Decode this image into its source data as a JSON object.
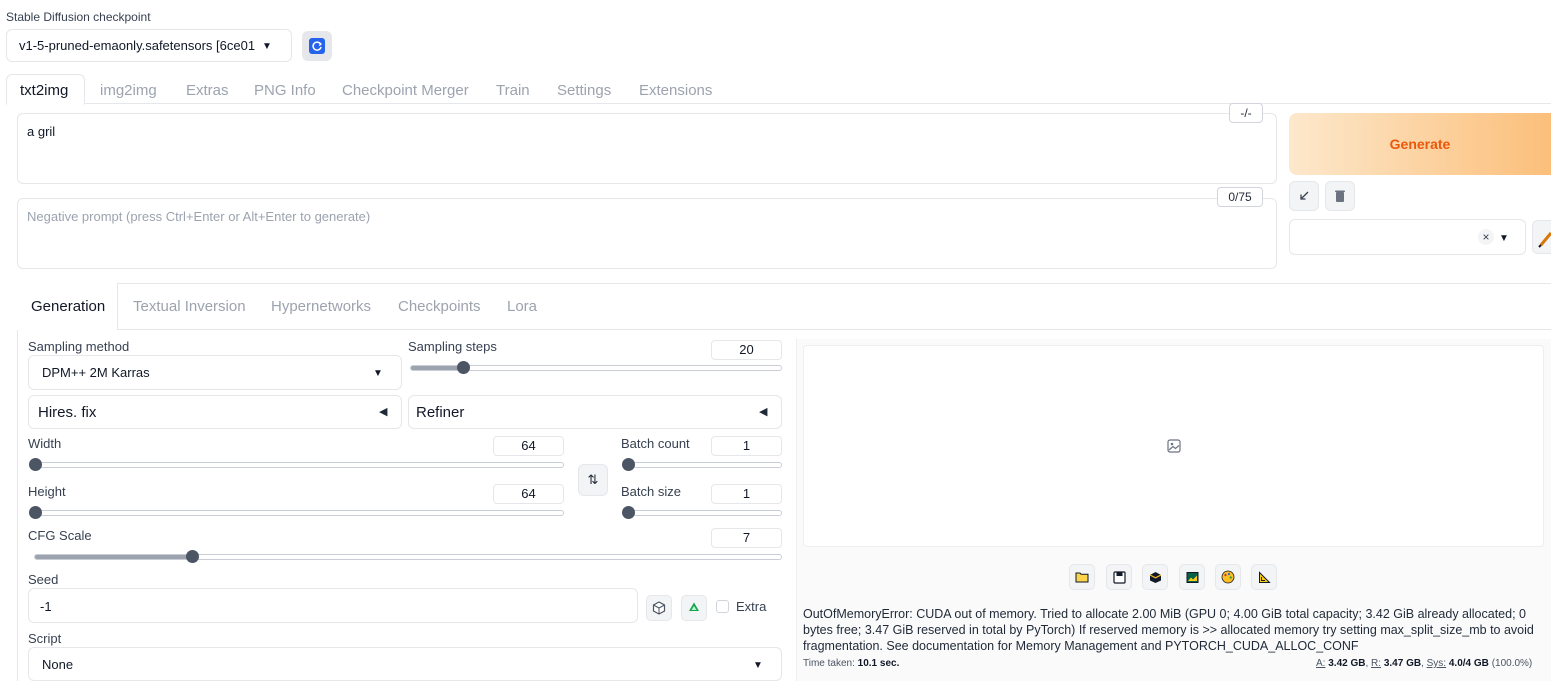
{
  "checkpoint": {
    "label": "Stable Diffusion checkpoint",
    "value": "v1-5-pruned-emaonly.safetensors [6ce01"
  },
  "main_tabs": [
    "txt2img",
    "img2img",
    "Extras",
    "PNG Info",
    "Checkpoint Merger",
    "Train",
    "Settings",
    "Extensions"
  ],
  "prompt": {
    "value": "a gril",
    "token_counter": "-/-"
  },
  "negative_prompt": {
    "placeholder": "Negative prompt (press Ctrl+Enter or Alt+Enter to generate)",
    "token_counter": "0/75"
  },
  "generate_label": "Generate",
  "styles": {
    "clear_symbol": "×"
  },
  "sub_tabs": [
    "Generation",
    "Textual Inversion",
    "Hypernetworks",
    "Checkpoints",
    "Lora"
  ],
  "sampling_method": {
    "label": "Sampling method",
    "value": "DPM++ 2M Karras"
  },
  "sampling_steps": {
    "label": "Sampling steps",
    "value": "20",
    "fraction": 0.14
  },
  "hires_fix": {
    "label": "Hires. fix"
  },
  "refiner": {
    "label": "Refiner"
  },
  "width": {
    "label": "Width",
    "value": "64",
    "fraction": 0.0
  },
  "height": {
    "label": "Height",
    "value": "64",
    "fraction": 0.0
  },
  "batch_count": {
    "label": "Batch count",
    "value": "1",
    "fraction": 0.0
  },
  "batch_size": {
    "label": "Batch size",
    "value": "1",
    "fraction": 0.0
  },
  "cfg_scale": {
    "label": "CFG Scale",
    "value": "7",
    "fraction": 0.21
  },
  "seed": {
    "label": "Seed",
    "value": "-1",
    "extra_label": "Extra"
  },
  "script": {
    "label": "Script",
    "value": "None"
  },
  "output": {
    "error_text": "OutOfMemoryError: CUDA out of memory. Tried to allocate 2.00 MiB (GPU 0; 4.00 GiB total capacity; 3.42 GiB already allocated; 0 bytes free; 3.47 GiB reserved in total by PyTorch) If reserved memory is >> allocated memory try setting max_split_size_mb to avoid fragmentation. See documentation for Memory Management and PYTORCH_CUDA_ALLOC_CONF",
    "time_label": "Time taken:",
    "time_value": "10.1 sec.",
    "mem_a_label": "A:",
    "mem_a": "3.42 GB",
    "mem_r_label": "R:",
    "mem_r": "3.47 GB",
    "mem_sys_label": "Sys:",
    "mem_sys": "4.0/4 GB",
    "mem_pct": "(100.0%)"
  },
  "colors": {
    "generate_gradient_start": "#fde4c4",
    "generate_gradient_end": "#fbb56d",
    "generate_text": "#ea580c",
    "accent_blue": "#2563eb"
  }
}
